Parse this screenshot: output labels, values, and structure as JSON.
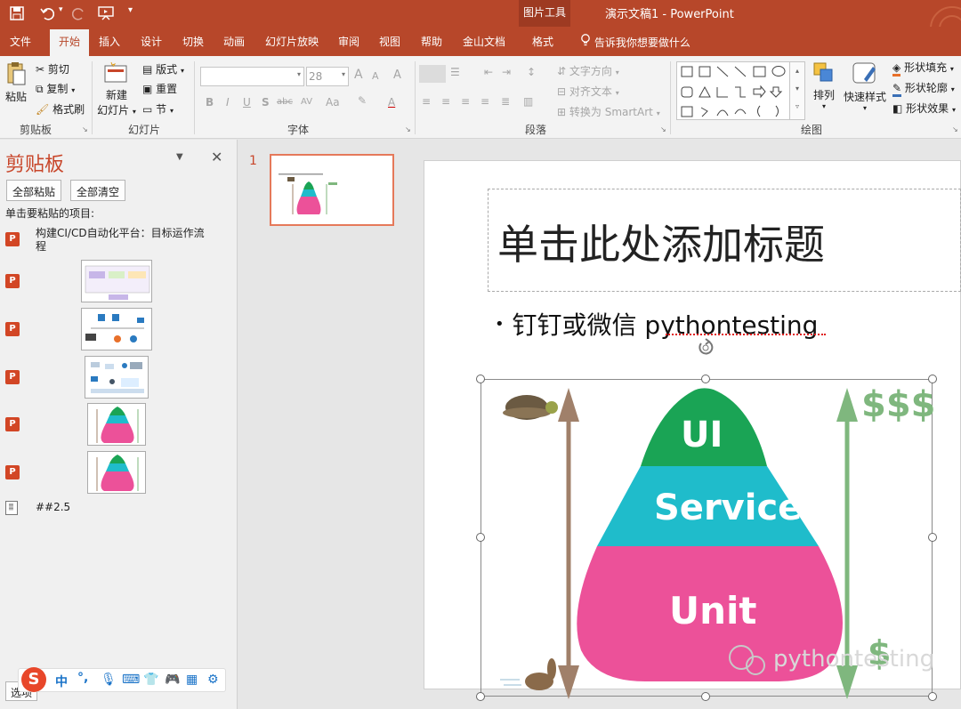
{
  "window": {
    "title": "演示文稿1  -  PowerPoint",
    "contextual_tab_group": "图片工具",
    "qat": {
      "undo_arrow": "▾",
      "customize": "▾"
    }
  },
  "tabs": [
    "文件",
    "开始",
    "插入",
    "设计",
    "切换",
    "动画",
    "幻灯片放映",
    "审阅",
    "视图",
    "帮助",
    "金山文档",
    "格式"
  ],
  "active_tab": "开始",
  "tell_me": "告诉我你想要做什么",
  "ribbon": {
    "clipboard": {
      "paste": "粘贴",
      "cut": "剪切",
      "copy": "复制",
      "format_painter": "格式刷",
      "group": "剪贴板"
    },
    "slides": {
      "new_slide_line1": "新建",
      "new_slide_line2": "幻灯片",
      "layout": "版式",
      "reset": "重置",
      "section": "节",
      "group": "幻灯片"
    },
    "font": {
      "font_name": "",
      "font_size": "28",
      "bold": "B",
      "italic": "I",
      "underline": "U",
      "shadow": "S",
      "strike": "abc",
      "spacing": "AV",
      "case": "Aa",
      "grow": "A",
      "shrink": "A",
      "clear": "A",
      "color": "A",
      "group": "字体"
    },
    "paragraph": {
      "text_direction": "文字方向",
      "align_text": "对齐文本",
      "smartart": "转换为 SmartArt",
      "group": "段落"
    },
    "drawing": {
      "arrange": "排列",
      "quick_styles": "快速样式",
      "fill": "形状填充",
      "outline": "形状轮廓",
      "effects": "形状效果",
      "group": "绘图"
    }
  },
  "clipboard_pane": {
    "title": "剪贴板",
    "paste_all": "全部粘贴",
    "clear_all": "全部清空",
    "instruction": "单击要粘贴的项目:",
    "items": [
      {
        "type": "text",
        "text": "构建CI/CD自动化平台：目标运作流程"
      },
      {
        "type": "image",
        "text": ""
      },
      {
        "type": "image",
        "text": ""
      },
      {
        "type": "image",
        "text": ""
      },
      {
        "type": "image",
        "text": ""
      },
      {
        "type": "image",
        "text": ""
      },
      {
        "type": "doc",
        "text": "##2.5"
      }
    ],
    "options": "选项"
  },
  "thumbnails": [
    {
      "number": "1"
    }
  ],
  "slide": {
    "title_placeholder": "单击此处添加标题",
    "bullet": "钉钉或微信  pythontesting",
    "pyramid": {
      "top": "UI",
      "middle": "Service",
      "bottom": "Unit"
    },
    "dollars_top": "$$$",
    "dollars_bottom": "$",
    "watermark": "pythontesting",
    "colors": {
      "ui": "#1aa455",
      "service": "#1fbccb",
      "unit": "#ec5199",
      "left_arrow": "#a0806a",
      "right_arrow": "#7fb77e"
    }
  },
  "ime_bar": {
    "mode": "中"
  }
}
